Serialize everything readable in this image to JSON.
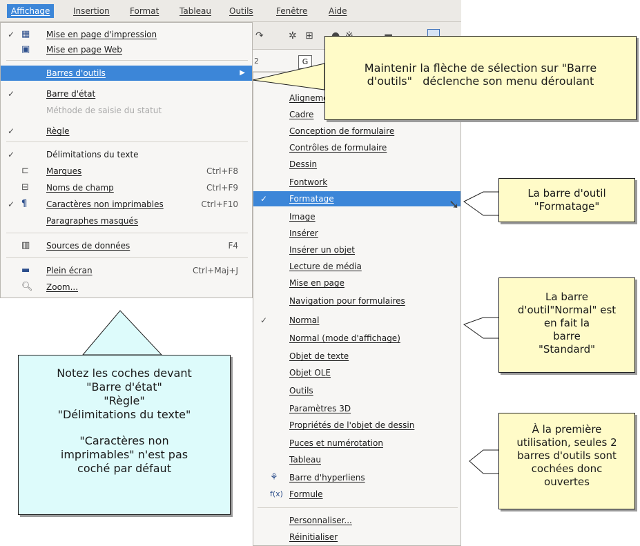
{
  "menubar": {
    "items": [
      "Affichage",
      "Insertion",
      "Format",
      "Tableau",
      "Outils",
      "Fenêtre",
      "Aide"
    ]
  },
  "ruler": {
    "number": "2",
    "box": "G"
  },
  "view_menu": {
    "items": [
      {
        "label": "Mise en page d'impression",
        "checked": true,
        "icon": "print-layout-icon",
        "shortcut": ""
      },
      {
        "label": "Mise en page Web",
        "checked": false,
        "icon": "web-layout-icon",
        "shortcut": ""
      },
      {
        "label": "Barres d'outils",
        "checked": false,
        "icon": "",
        "shortcut": "",
        "highlighted": true,
        "submenu": true
      },
      {
        "label": "Barre d'état",
        "checked": true,
        "icon": "",
        "shortcut": ""
      },
      {
        "label": "Méthode de saisie du statut",
        "checked": false,
        "icon": "",
        "shortcut": "",
        "disabled": true
      },
      {
        "label": "Règle",
        "checked": true,
        "icon": "",
        "shortcut": ""
      },
      {
        "label": "Délimitations du texte",
        "checked": true,
        "icon": "",
        "shortcut": ""
      },
      {
        "label": "Marques",
        "checked": false,
        "icon": "field-shading-icon",
        "shortcut": "Ctrl+F8"
      },
      {
        "label": "Noms de champ",
        "checked": false,
        "icon": "field-names-icon",
        "shortcut": "Ctrl+F9"
      },
      {
        "label": "Caractères non imprimables",
        "checked": true,
        "icon": "formatting-marks-icon",
        "shortcut": "Ctrl+F10"
      },
      {
        "label": "Paragraphes masqués",
        "checked": false,
        "icon": "",
        "shortcut": ""
      },
      {
        "label": "Sources de données",
        "checked": false,
        "icon": "data-sources-icon",
        "shortcut": "F4"
      },
      {
        "label": "Plein écran",
        "checked": false,
        "icon": "full-screen-icon",
        "shortcut": "Ctrl+Maj+J"
      },
      {
        "label": "Zoom...",
        "checked": false,
        "icon": "zoom-icon",
        "shortcut": ""
      }
    ]
  },
  "toolbars_submenu": {
    "items": [
      {
        "label": "Alignement",
        "checked": false
      },
      {
        "label": "Cadre",
        "checked": false
      },
      {
        "label": "Conception de formulaire",
        "checked": false
      },
      {
        "label": "Contrôles de formulaire",
        "checked": false
      },
      {
        "label": "Dessin",
        "checked": false
      },
      {
        "label": "Fontwork",
        "checked": false
      },
      {
        "label": "Formatage",
        "checked": true,
        "highlighted": true
      },
      {
        "label": "Image",
        "checked": false
      },
      {
        "label": "Insérer",
        "checked": false
      },
      {
        "label": "Insérer un objet",
        "checked": false
      },
      {
        "label": "Lecture de média",
        "checked": false
      },
      {
        "label": "Mise en page",
        "checked": false
      },
      {
        "label": "Navigation pour formulaires",
        "checked": false
      },
      {
        "label": "Normal",
        "checked": true
      },
      {
        "label": "Normal (mode d'affichage)",
        "checked": false
      },
      {
        "label": "Objet de texte",
        "checked": false
      },
      {
        "label": "Objet OLE",
        "checked": false
      },
      {
        "label": "Outils",
        "checked": false
      },
      {
        "label": "Paramètres 3D",
        "checked": false
      },
      {
        "label": "Propriétés de l'objet de dessin",
        "checked": false
      },
      {
        "label": "Puces et numérotation",
        "checked": false
      },
      {
        "label": "Tableau",
        "checked": false
      },
      {
        "label": "Barre d'hyperliens",
        "checked": false,
        "icon": "hyperlink-bar-icon"
      },
      {
        "label": "Formule",
        "checked": false,
        "icon": "formula-icon"
      },
      {
        "label": "Personnaliser...",
        "checked": false
      },
      {
        "label": "Réinitialiser",
        "checked": false
      }
    ]
  },
  "callouts": {
    "top": [
      "Maintenir la flèche de sélection sur \"Barre",
      "d'outils\"   déclenche son menu déroulant"
    ],
    "cyan": [
      "Notez les coches devant",
      "\"Barre d'état\"",
      "\"Règle\"",
      "\"Délimitations du texte\"",
      "",
      "\"Caractères non",
      "imprimables\" n'est pas",
      "coché par défaut"
    ],
    "formatage": [
      "La barre d'outil",
      "\"Formatage\""
    ],
    "normal": [
      "La barre",
      "d'outil\"Normal\" est",
      "en fait la",
      "barre",
      "\"Standard\""
    ],
    "first_use": [
      "À la première",
      "utilisation, seules 2",
      "barres d'outils sont",
      "cochées donc",
      "ouvertes"
    ]
  },
  "colors": {
    "highlight": "#3c86d8",
    "callout_yellow": "#fffbc8",
    "callout_cyan": "#ddfbfb"
  }
}
